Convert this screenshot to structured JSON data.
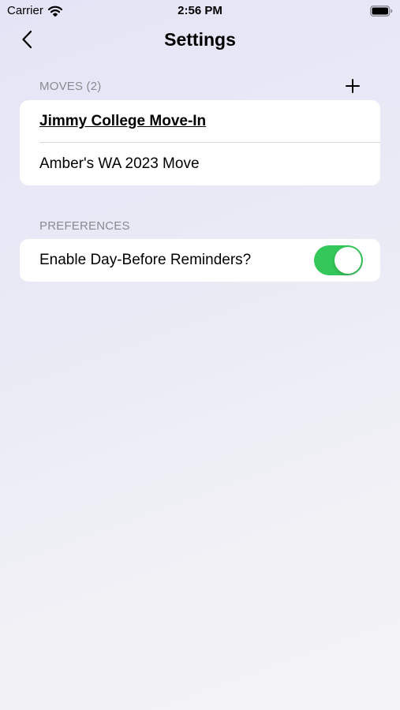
{
  "status_bar": {
    "carrier": "Carrier",
    "time": "2:56 PM"
  },
  "nav": {
    "title": "Settings"
  },
  "moves_section": {
    "header": "MOVES (2)",
    "items": [
      {
        "label": "Jimmy College Move-In",
        "selected": true
      },
      {
        "label": "Amber's WA 2023 Move",
        "selected": false
      }
    ]
  },
  "preferences_section": {
    "header": "PREFERENCES",
    "day_before_reminders": {
      "label": "Enable Day-Before Reminders?",
      "enabled": true
    }
  },
  "colors": {
    "toggle_on": "#34c759",
    "section_header": "#8a8a90"
  },
  "icons": [
    "wifi-icon",
    "battery-icon",
    "chevron-left-icon",
    "plus-icon"
  ]
}
